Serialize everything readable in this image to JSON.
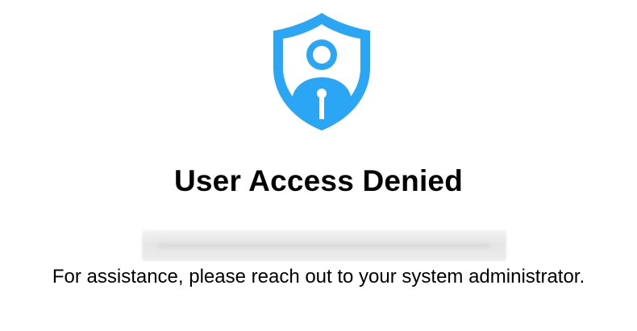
{
  "icon": {
    "name": "shield-user-icon",
    "color": "#2aa6f5"
  },
  "title": "User Access Denied",
  "redacted_account": {
    "blurred": true,
    "background": "#eeeeee"
  },
  "message": "For assistance, please reach out to your system administrator."
}
